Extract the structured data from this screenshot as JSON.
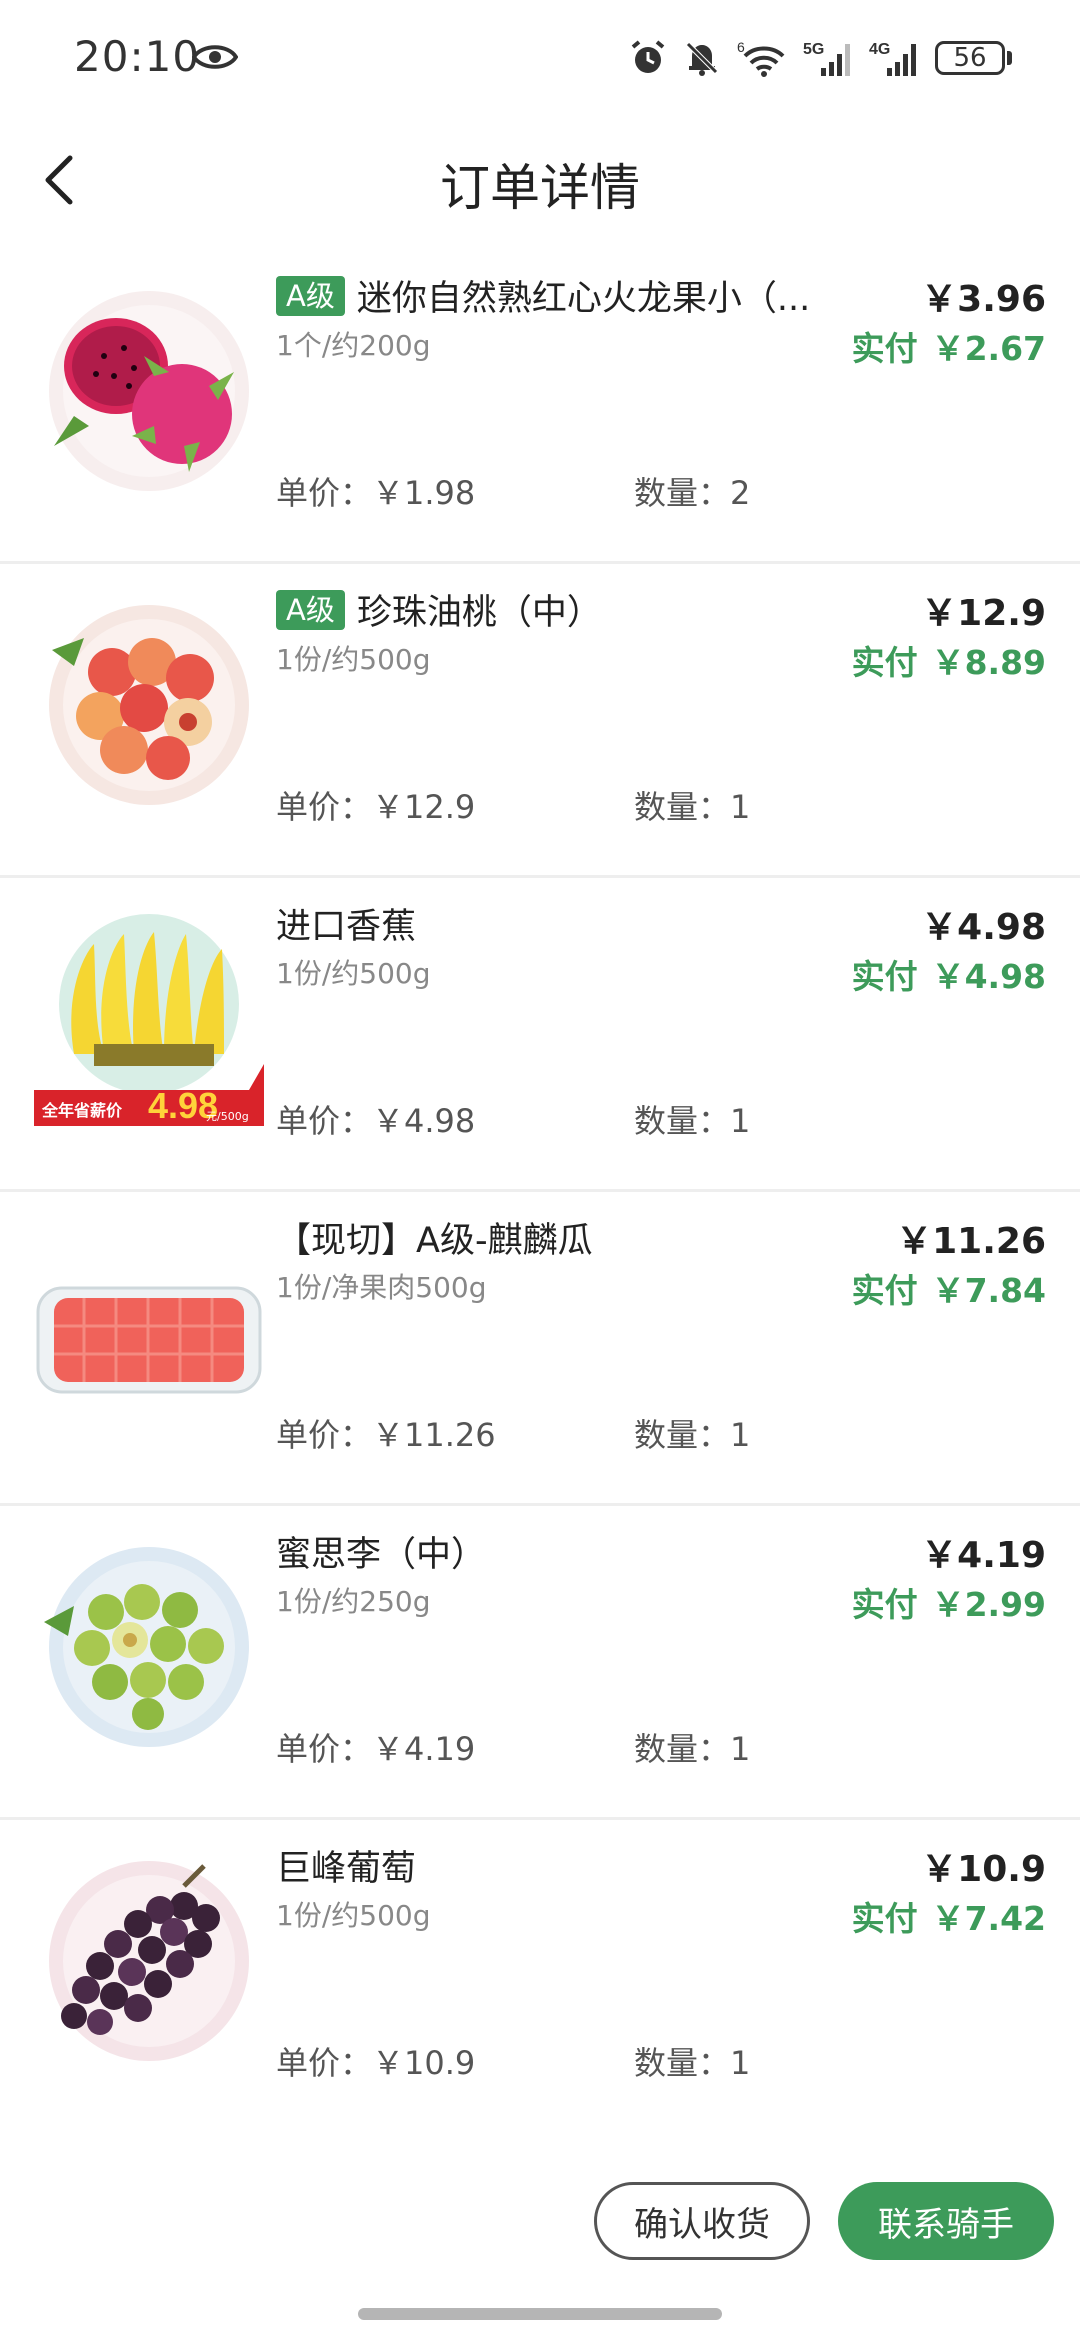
{
  "status_bar": {
    "time": "20:10",
    "battery": "56",
    "icons": [
      "eye-icon",
      "alarm-icon",
      "bell-off-icon",
      "wifi-icon",
      "signal-5g-icon",
      "signal-4g-icon",
      "battery-icon"
    ],
    "network_5g": "5G",
    "network_4g": "4G",
    "wifi_badge": "6"
  },
  "header": {
    "title": "订单详情",
    "back_icon": "chevron-left-icon"
  },
  "items": [
    {
      "grade": "A级",
      "name": "迷你自然熟红心火龙果小（...",
      "spec": "1个/约200g",
      "price": "￥3.96",
      "paid_label": "实付",
      "paid": "￥2.67",
      "unit_price": "单价：￥1.98",
      "quantity": "数量：2",
      "image": "dragon-fruit-image"
    },
    {
      "grade": "A级",
      "name": "珍珠油桃（中）",
      "spec": "1份/约500g",
      "price": "￥12.9",
      "paid_label": "实付",
      "paid": "￥8.89",
      "unit_price": "单价：￥12.9",
      "quantity": "数量：1",
      "image": "nectarine-image"
    },
    {
      "grade": "",
      "name": "进口香蕉",
      "spec": "1份/约500g",
      "price": "￥4.98",
      "paid_label": "实付",
      "paid": "￥4.98",
      "unit_price": "单价：￥4.98",
      "quantity": "数量：1",
      "image": "banana-image",
      "promo_text": "全年省薪价",
      "promo_price": "4.98",
      "promo_unit": "元/500g"
    },
    {
      "grade": "",
      "name": "【现切】A级-麒麟瓜",
      "spec": "1份/净果肉500g",
      "price": "￥11.26",
      "paid_label": "实付",
      "paid": "￥7.84",
      "unit_price": "单价：￥11.26",
      "quantity": "数量：1",
      "image": "cut-watermelon-image"
    },
    {
      "grade": "",
      "name": "蜜思李（中）",
      "spec": "1份/约250g",
      "price": "￥4.19",
      "paid_label": "实付",
      "paid": "￥2.99",
      "unit_price": "单价：￥4.19",
      "quantity": "数量：1",
      "image": "plum-image"
    },
    {
      "grade": "",
      "name": "巨峰葡萄",
      "spec": "1份/约500g",
      "price": "￥10.9",
      "paid_label": "实付",
      "paid": "￥7.42",
      "unit_price": "单价：￥10.9",
      "quantity": "数量：1",
      "image": "grape-image"
    }
  ],
  "bottom_bar": {
    "confirm_label": "确认收货",
    "contact_label": "联系骑手"
  },
  "colors": {
    "accent_green": "#3d9b5a",
    "text_dark": "#222222",
    "text_gray": "#888888",
    "divider": "#eeeeee"
  }
}
